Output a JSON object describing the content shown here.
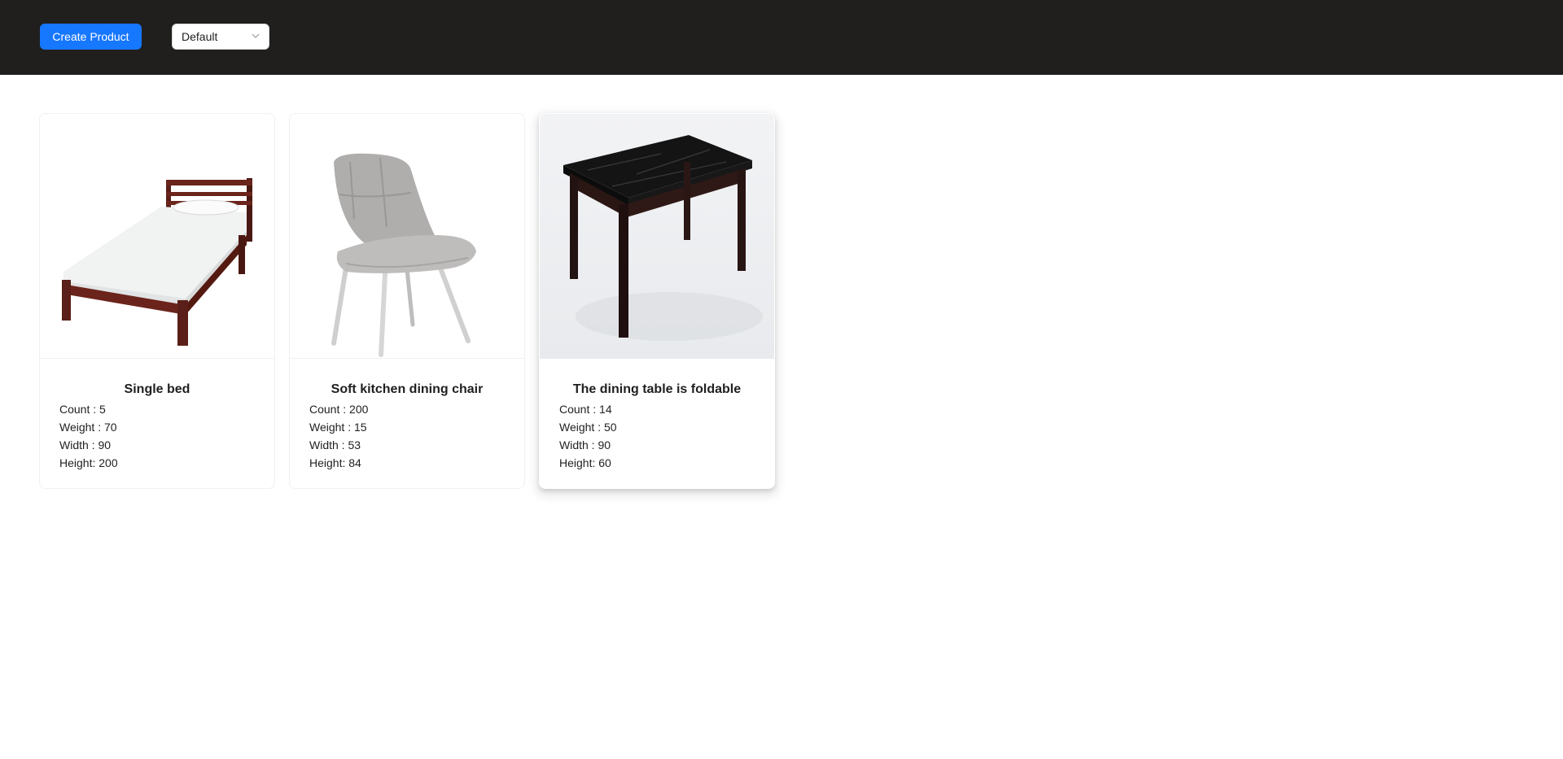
{
  "toolbar": {
    "create_label": "Create Product",
    "sort_value": "Default"
  },
  "products": [
    {
      "name": "Single bed",
      "count": "Count : 5",
      "weight": "Weight : 70",
      "width": "Width : 90",
      "height": "Height: 200",
      "image_icon": "bed-icon"
    },
    {
      "name": "Soft kitchen dining chair",
      "count": "Count : 200",
      "weight": "Weight : 15",
      "width": "Width : 53",
      "height": "Height: 84",
      "image_icon": "chair-icon"
    },
    {
      "name": "The dining table is foldable",
      "count": "Count : 14",
      "weight": "Weight : 50",
      "width": "Width : 90",
      "height": "Height: 60",
      "image_icon": "table-icon"
    }
  ],
  "colors": {
    "header_bg": "#201f1d",
    "primary": "#1677ff"
  }
}
